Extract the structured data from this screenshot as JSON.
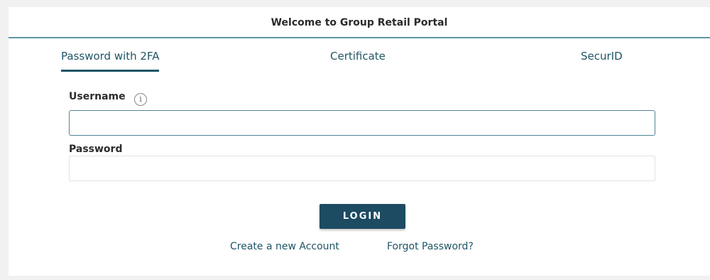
{
  "header": {
    "title": "Welcome to Group Retail Portal"
  },
  "tabs": [
    {
      "label": "Password with 2FA",
      "active": true
    },
    {
      "label": "Certificate",
      "active": false
    },
    {
      "label": "SecurID",
      "active": false
    }
  ],
  "form": {
    "username": {
      "label": "Username",
      "value": "",
      "placeholder": "",
      "info_icon": "info-icon"
    },
    "password": {
      "label": "Password",
      "value": "",
      "placeholder": ""
    },
    "login_label": "LOGIN"
  },
  "links": {
    "create_account": "Create a new Account",
    "forgot_password": "Forgot Password?"
  },
  "colors": {
    "accent": "#1c4b62",
    "link": "#1f5566",
    "header_rule": "#5e95a8"
  }
}
